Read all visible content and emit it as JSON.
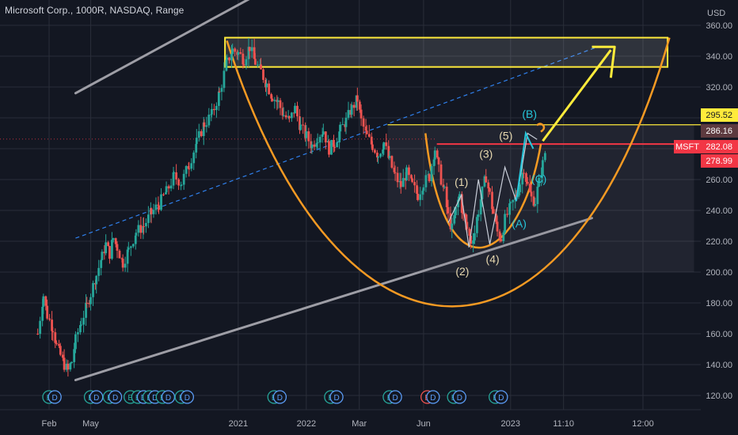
{
  "header": {
    "title": "Microsoft Corp., 1000R, NASDAQ, Range"
  },
  "chart_data": {
    "type": "candlestick",
    "currency": "USD",
    "symbol": "MSFT",
    "ylim": [
      110,
      365
    ],
    "y_ticks": [
      120,
      140,
      160,
      180,
      200,
      220,
      240,
      260,
      280,
      300,
      320,
      340,
      360
    ],
    "x_ticks": [
      {
        "label": "Feb",
        "x": 0.06
      },
      {
        "label": "May",
        "x": 0.28
      },
      {
        "label": "2021",
        "x": 1.06
      },
      {
        "label": "2022",
        "x": 1.42
      },
      {
        "label": "Mar",
        "x": 1.7
      },
      {
        "label": "Jun",
        "x": 2.04
      },
      {
        "label": "2023",
        "x": 2.5
      },
      {
        "label": "11:10",
        "x": 2.78
      },
      {
        "label": "12:00",
        "x": 3.2
      }
    ],
    "xlim": [
      -0.2,
      3.47
    ],
    "price_labels": [
      {
        "text": "295.52",
        "value": 295.52,
        "kind": "yellow"
      },
      {
        "text": "286.16",
        "value": 286.16,
        "kind": "dark"
      },
      {
        "text": "282.08",
        "value": 282.08,
        "kind": "red",
        "symbol": "MSFT"
      },
      {
        "text": "278.99",
        "value": 278.99,
        "kind": "red"
      }
    ],
    "price_path": [
      [
        0.0,
        160
      ],
      [
        0.03,
        185
      ],
      [
        0.05,
        172
      ],
      [
        0.08,
        164
      ],
      [
        0.1,
        152
      ],
      [
        0.12,
        146
      ],
      [
        0.14,
        140
      ],
      [
        0.16,
        136
      ],
      [
        0.18,
        142
      ],
      [
        0.2,
        156
      ],
      [
        0.23,
        168
      ],
      [
        0.26,
        178
      ],
      [
        0.28,
        186
      ],
      [
        0.31,
        198
      ],
      [
        0.34,
        210
      ],
      [
        0.36,
        218
      ],
      [
        0.38,
        212
      ],
      [
        0.4,
        222
      ],
      [
        0.42,
        216
      ],
      [
        0.45,
        206
      ],
      [
        0.48,
        214
      ],
      [
        0.52,
        226
      ],
      [
        0.56,
        230
      ],
      [
        0.6,
        238
      ],
      [
        0.64,
        244
      ],
      [
        0.68,
        252
      ],
      [
        0.72,
        262
      ],
      [
        0.76,
        258
      ],
      [
        0.8,
        270
      ],
      [
        0.84,
        284
      ],
      [
        0.88,
        296
      ],
      [
        0.92,
        302
      ],
      [
        0.96,
        316
      ],
      [
        1.0,
        336
      ],
      [
        1.03,
        344
      ],
      [
        1.06,
        342
      ],
      [
        1.09,
        338
      ],
      [
        1.12,
        346
      ],
      [
        1.15,
        336
      ],
      [
        1.18,
        330
      ],
      [
        1.21,
        322
      ],
      [
        1.24,
        314
      ],
      [
        1.27,
        310
      ],
      [
        1.3,
        302
      ],
      [
        1.33,
        298
      ],
      [
        1.36,
        306
      ],
      [
        1.39,
        294
      ],
      [
        1.42,
        288
      ],
      [
        1.45,
        282
      ],
      [
        1.48,
        288
      ],
      [
        1.51,
        292
      ],
      [
        1.54,
        280
      ],
      [
        1.57,
        284
      ],
      [
        1.6,
        292
      ],
      [
        1.63,
        298
      ],
      [
        1.66,
        306
      ],
      [
        1.69,
        312
      ],
      [
        1.71,
        298
      ],
      [
        1.74,
        288
      ],
      [
        1.77,
        282
      ],
      [
        1.8,
        276
      ],
      [
        1.83,
        284
      ],
      [
        1.86,
        272
      ],
      [
        1.89,
        262
      ],
      [
        1.92,
        256
      ],
      [
        1.95,
        264
      ],
      [
        1.98,
        256
      ],
      [
        2.01,
        250
      ],
      [
        2.04,
        258
      ],
      [
        2.07,
        262
      ],
      [
        2.1,
        280
      ],
      [
        2.12,
        266
      ],
      [
        2.15,
        252
      ],
      [
        2.17,
        236
      ],
      [
        2.19,
        228
      ],
      [
        2.21,
        240
      ],
      [
        2.23,
        250
      ],
      [
        2.25,
        236
      ],
      [
        2.27,
        228
      ],
      [
        2.29,
        220
      ],
      [
        2.31,
        226
      ],
      [
        2.33,
        240
      ],
      [
        2.35,
        252
      ],
      [
        2.37,
        262
      ],
      [
        2.39,
        250
      ],
      [
        2.41,
        238
      ],
      [
        2.43,
        226
      ],
      [
        2.45,
        222
      ],
      [
        2.47,
        234
      ],
      [
        2.5,
        242
      ],
      [
        2.53,
        250
      ],
      [
        2.55,
        258
      ],
      [
        2.57,
        268
      ],
      [
        2.59,
        256
      ],
      [
        2.61,
        248
      ],
      [
        2.63,
        246
      ],
      [
        2.65,
        258
      ],
      [
        2.67,
        270
      ],
      [
        2.69,
        282
      ]
    ],
    "wave_labels": [
      {
        "text": "(1)",
        "x": 2.24,
        "y": 256,
        "color": "#e8d9b0"
      },
      {
        "text": "(2)",
        "x": 2.245,
        "y": 198,
        "color": "#e8d9b0"
      },
      {
        "text": "(3)",
        "x": 2.37,
        "y": 274,
        "color": "#e8d9b0"
      },
      {
        "text": "(4)",
        "x": 2.405,
        "y": 206,
        "color": "#e8d9b0"
      },
      {
        "text": "(5)",
        "x": 2.475,
        "y": 286,
        "color": "#e8d9b0"
      },
      {
        "text": "(A)",
        "x": 2.545,
        "y": 229,
        "color": "#26c6da"
      },
      {
        "text": "(B)",
        "x": 2.6,
        "y": 300,
        "color": "#26c6da"
      },
      {
        "text": "(C)",
        "x": 2.65,
        "y": 258,
        "color": "#26c6da"
      }
    ],
    "events": [
      {
        "kind": "E",
        "x": 0.06
      },
      {
        "kind": "D",
        "x": 0.09
      },
      {
        "kind": "E",
        "x": 0.28
      },
      {
        "kind": "D",
        "x": 0.31
      },
      {
        "kind": "E",
        "x": 0.38
      },
      {
        "kind": "D",
        "x": 0.41
      },
      {
        "kind": "E",
        "x": 0.49
      },
      {
        "kind": "E",
        "x": 0.53
      },
      {
        "kind": "D",
        "x": 0.56
      },
      {
        "kind": "E",
        "x": 0.59
      },
      {
        "kind": "D",
        "x": 0.62
      },
      {
        "kind": "E",
        "x": 0.66
      },
      {
        "kind": "D",
        "x": 0.69
      },
      {
        "kind": "E",
        "x": 0.76
      },
      {
        "kind": "D",
        "x": 0.79
      },
      {
        "kind": "E",
        "x": 1.25
      },
      {
        "kind": "D",
        "x": 1.28
      },
      {
        "kind": "E",
        "x": 1.55
      },
      {
        "kind": "D",
        "x": 1.58
      },
      {
        "kind": "E",
        "x": 1.86
      },
      {
        "kind": "D",
        "x": 1.89
      },
      {
        "kind": "E",
        "x": 2.06,
        "red": true
      },
      {
        "kind": "D",
        "x": 2.09
      },
      {
        "kind": "E",
        "x": 2.2
      },
      {
        "kind": "D",
        "x": 2.23
      },
      {
        "kind": "E",
        "x": 2.42
      },
      {
        "kind": "D",
        "x": 2.45
      }
    ],
    "colors": {
      "up": "#26a69a",
      "down": "#ef5350",
      "background": "#131722",
      "grid": "#2a2e39",
      "text": "#b2b5be",
      "channel": "#9e9ea6",
      "cup": "#f59a23",
      "highlight": "#ffeb3b",
      "wave": "#26c6da"
    }
  }
}
